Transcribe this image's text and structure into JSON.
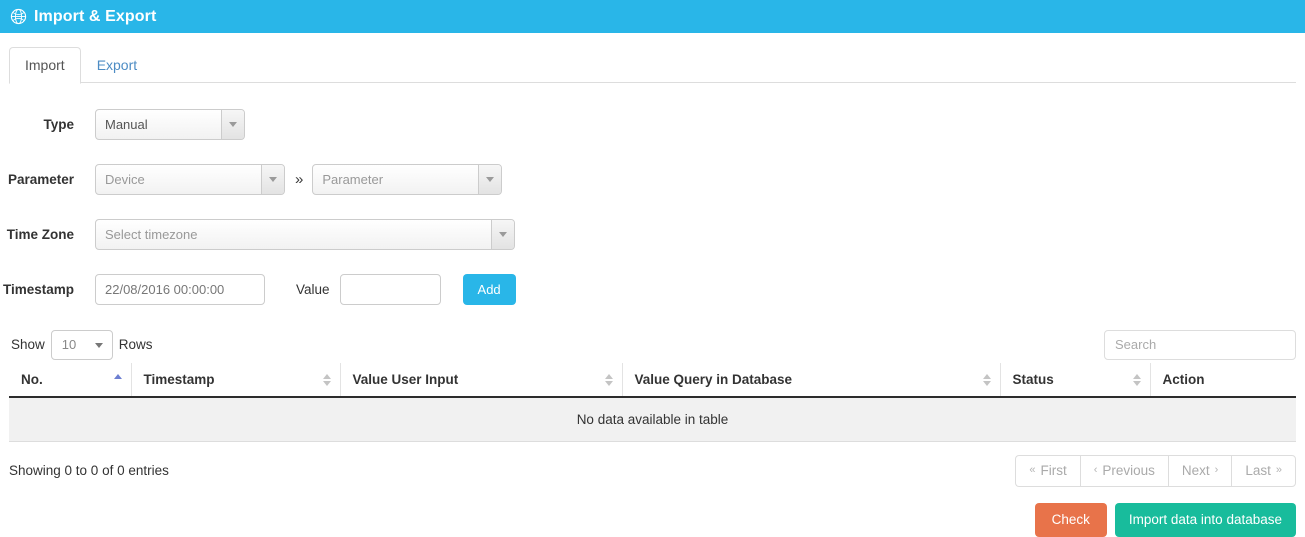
{
  "header": {
    "icon": "globe-icon",
    "title": "Import & Export",
    "bg_color": "#29b6e8"
  },
  "tabs": [
    {
      "label": "Import",
      "active": true
    },
    {
      "label": "Export",
      "active": false
    }
  ],
  "form": {
    "type": {
      "label": "Type",
      "value": "Manual",
      "is_placeholder": false
    },
    "parameter": {
      "label": "Parameter",
      "device": {
        "value": "Device",
        "is_placeholder": true
      },
      "separator": "»",
      "parameter": {
        "value": "Parameter",
        "is_placeholder": true
      }
    },
    "timezone": {
      "label": "Time Zone",
      "value": "Select timezone",
      "is_placeholder": true
    },
    "timestamp": {
      "label": "Timestamp",
      "value": "22/08/2016 00:00:00"
    },
    "value": {
      "label": "Value",
      "value": "",
      "placeholder": ""
    },
    "add_button": "Add"
  },
  "table_controls": {
    "show_label": "Show",
    "rows_value": "10",
    "rows_label": "Rows",
    "search_placeholder": "Search",
    "search_value": ""
  },
  "table": {
    "columns": [
      {
        "label": "No.",
        "sort": "asc"
      },
      {
        "label": "Timestamp",
        "sort": "none"
      },
      {
        "label": "Value User Input",
        "sort": "none"
      },
      {
        "label": "Value Query in Database",
        "sort": "none"
      },
      {
        "label": "Status",
        "sort": "none"
      },
      {
        "label": "Action",
        "sort": "off"
      }
    ],
    "rows": [],
    "empty_message": "No data available in table"
  },
  "footer": {
    "entries_info": "Showing 0 to 0 of 0 entries",
    "pagination": [
      {
        "label": "First",
        "icon": "«",
        "icon_pos": "left"
      },
      {
        "label": "Previous",
        "icon": "‹",
        "icon_pos": "left"
      },
      {
        "label": "Next",
        "icon": "›",
        "icon_pos": "right"
      },
      {
        "label": "Last",
        "icon": "»",
        "icon_pos": "right"
      }
    ]
  },
  "actions": {
    "check_label": "Check",
    "check_color": "#e8734a",
    "import_label": "Import data into database",
    "import_color": "#18bc9c"
  }
}
